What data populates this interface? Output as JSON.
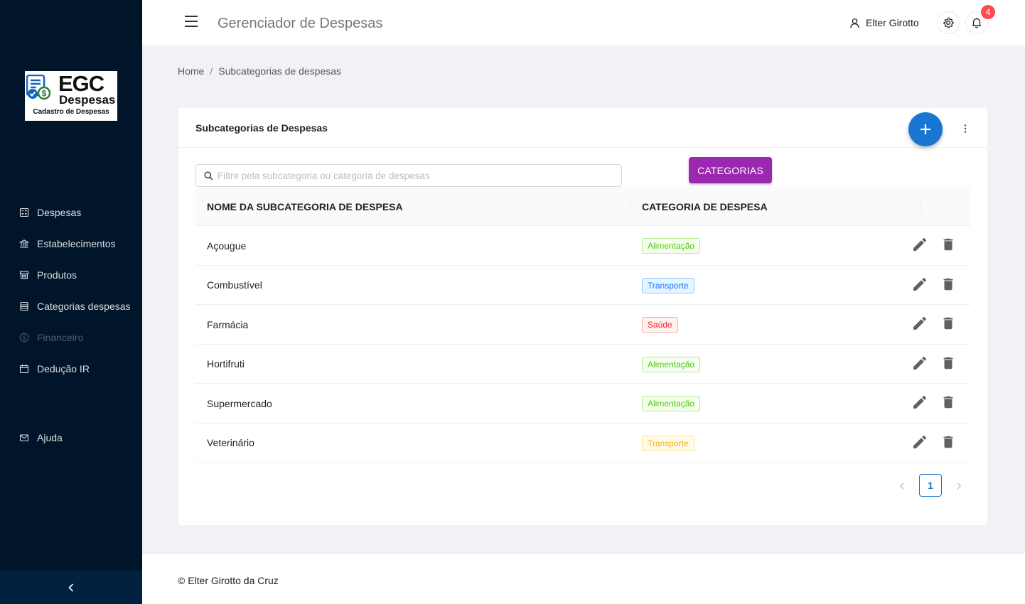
{
  "brand": {
    "logo_main": "EGC",
    "logo_sub": "Despesas",
    "logo_caption": "Cadastro de Despesas"
  },
  "sidebar": {
    "items": [
      {
        "label": "Despesas",
        "icon": "calculator-icon",
        "enabled": true
      },
      {
        "label": "Estabelecimentos",
        "icon": "bank-icon",
        "enabled": true
      },
      {
        "label": "Produtos",
        "icon": "shop-icon",
        "enabled": true
      },
      {
        "label": "Categorias despesas",
        "icon": "list-icon",
        "enabled": true
      },
      {
        "label": "Financeiro",
        "icon": "dollar-icon",
        "enabled": false
      },
      {
        "label": "Dedução IR",
        "icon": "calendar-icon",
        "enabled": true
      },
      {
        "label": "Ajuda",
        "icon": "mail-icon",
        "enabled": true
      }
    ],
    "collapse_icon": "chevron-left-icon"
  },
  "header": {
    "title": "Gerenciador de Despesas",
    "user_name": "Elter Girotto",
    "notification_count": "4"
  },
  "breadcrumb": {
    "home": "Home",
    "separator": "/",
    "current": "Subcategorias de despesas"
  },
  "card": {
    "title": "Subcategorias de Despesas",
    "search_placeholder": "Filtre pela subcategoria ou categoria de despesas",
    "categories_button": "CATEGORIAS"
  },
  "table": {
    "columns": [
      "NOME DA SUBCATEGORIA DE DESPESA",
      "CATEGORIA DE DESPESA"
    ],
    "rows": [
      {
        "name": "Açougue",
        "category": "Alimentação",
        "tag_color": "green"
      },
      {
        "name": "Combustível",
        "category": "Transporte",
        "tag_color": "blue"
      },
      {
        "name": "Farmácia",
        "category": "Saúde",
        "tag_color": "red"
      },
      {
        "name": "Hortifruti",
        "category": "Alimentação",
        "tag_color": "green"
      },
      {
        "name": "Supermercado",
        "category": "Alimentação",
        "tag_color": "green"
      },
      {
        "name": "Veterinário",
        "category": "Transporte",
        "tag_color": "gold"
      }
    ]
  },
  "tag_palette": {
    "green": {
      "fg": "#52c41a",
      "bg": "#f6ffed",
      "border": "#b7eb8f"
    },
    "blue": {
      "fg": "#1677ff",
      "bg": "#e6f4ff",
      "border": "#91caff"
    },
    "red": {
      "fg": "#f5222d",
      "bg": "#fff1f0",
      "border": "#ffa39e"
    },
    "gold": {
      "fg": "#faad14",
      "bg": "#fffbe6",
      "border": "#ffe58f"
    }
  },
  "pagination": {
    "current_page": "1"
  },
  "footer": {
    "text": "© Elter Girotto da Cruz"
  },
  "colors": {
    "sidebar_bg": "#001529",
    "primary": "#1976d2",
    "categories_button": "#9c27b0",
    "badge": "#ff4d4f"
  }
}
